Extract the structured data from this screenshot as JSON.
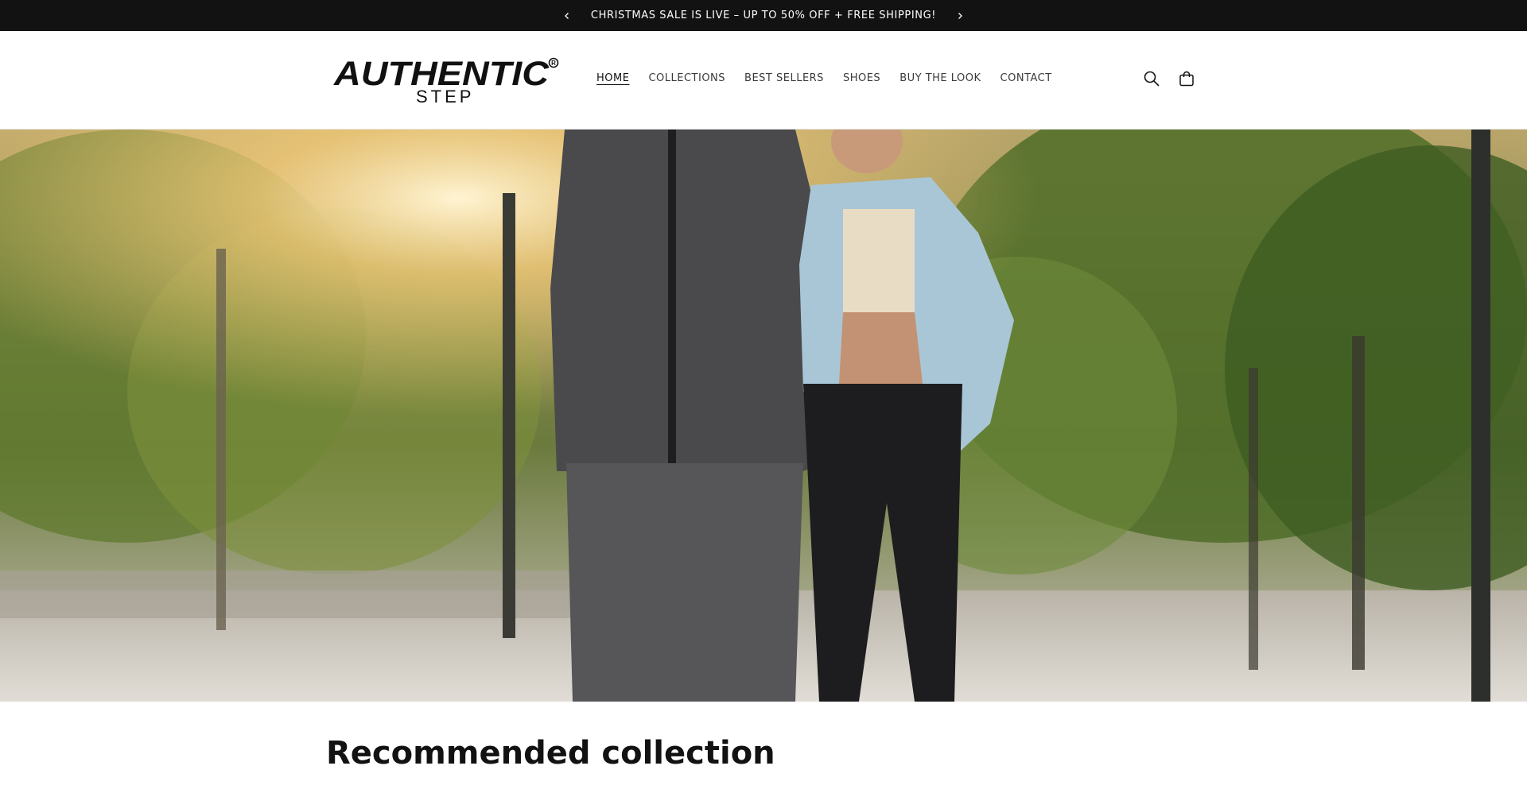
{
  "announcement": {
    "text": "CHRISTMAS SALE IS LIVE – UP TO 50% OFF + FREE SHIPPING!",
    "prev_icon": "chevron-left-icon",
    "next_icon": "chevron-right-icon"
  },
  "brand": {
    "name_main": "AUTHENTIC",
    "name_sub": "STEP",
    "registered_mark": "®"
  },
  "nav": {
    "items": [
      {
        "label": "HOME",
        "active": true
      },
      {
        "label": "COLLECTIONS",
        "active": false
      },
      {
        "label": "BEST SELLERS",
        "active": false
      },
      {
        "label": "SHOES",
        "active": false
      },
      {
        "label": "BUY THE LOOK",
        "active": false
      },
      {
        "label": "CONTACT",
        "active": false
      }
    ]
  },
  "header_icons": {
    "search": "search-icon",
    "cart": "cart-icon"
  },
  "hero": {
    "image": "couple-walking-hero-image"
  },
  "sections": {
    "recommended_title": "Recommended collection"
  },
  "colors": {
    "announcement_bg": "#121212",
    "text": "#121212"
  }
}
